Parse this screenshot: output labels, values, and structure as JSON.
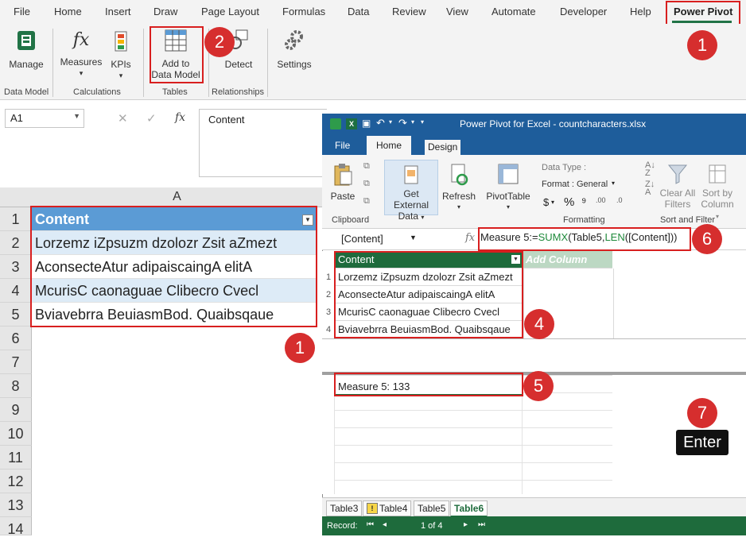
{
  "excel": {
    "menu": [
      "File",
      "Home",
      "Insert",
      "Draw",
      "Page Layout",
      "Formulas",
      "Data",
      "Review",
      "View",
      "Automate",
      "Developer",
      "Help",
      "Power Pivot"
    ],
    "ribbon": {
      "manage": "Manage",
      "measures": "Measures",
      "kpis": "KPIs",
      "add_to_data_model_1": "Add to",
      "add_to_data_model_2": "Data Model",
      "detect": "Detect",
      "settings": "Settings",
      "groups": [
        "Data Model",
        "Calculations",
        "Tables",
        "Relationships"
      ]
    },
    "name_box": "A1",
    "fx": "fx",
    "formula_value": "Content",
    "column_header": "A",
    "rows": [
      "1",
      "2",
      "3",
      "4",
      "5",
      "6",
      "7",
      "8",
      "9",
      "10",
      "11",
      "12",
      "13",
      "14"
    ],
    "cells": [
      "Content",
      "Lorzemz iZpsuzm dzolozr Zsit aZmezt",
      "AconsecteAtur adipaiscaingA elitA",
      "McurisC caonaguae Clibecro Cvecl",
      "Bviavebrra BeuiasmBod. Quaibsqaue"
    ]
  },
  "callouts": [
    "1",
    "2",
    "1",
    "6",
    "4",
    "5",
    "7"
  ],
  "enter_label": "Enter",
  "powerpivot": {
    "title": "Power Pivot for Excel - countcharacters.xlsx",
    "tabs": [
      "File",
      "Home",
      "Design"
    ],
    "ribbon": {
      "paste": "Paste",
      "get_external_1": "Get External",
      "get_external_2": "Data",
      "refresh": "Refresh",
      "pivottable": "PivotTable",
      "data_type": "Data Type :",
      "format": "Format : General",
      "clear_filters_1": "Clear All",
      "clear_filters_2": "Filters",
      "sort_col_1": "Sort by",
      "sort_col_2": "Column",
      "groups": [
        "Clipboard",
        "Formatting",
        "Sort and Filter"
      ]
    },
    "column_selector": "[Content]",
    "formula_prefix": "Measure 5:=",
    "formula_fn1": "SUMX",
    "formula_mid": "(Table5,",
    "formula_fn2": "LEN",
    "formula_end": "([Content]))",
    "grid_header": "Content",
    "add_column": "Add Column",
    "grid_rows": [
      "1",
      "2",
      "3",
      "4"
    ],
    "grid_values": [
      "Lorzemz iZpsuzm dzolozr Zsit aZmezt",
      "AconsecteAtur adipaiscaingA elitA",
      "McurisC caonaguae Clibecro Cvecl",
      "Bviavebrra BeuiasmBod. Quaibsqaue"
    ],
    "measure": "Measure 5: 133",
    "sheet_tabs": [
      "Table3",
      "Table4",
      "Table5",
      "Table6"
    ],
    "record_label": "Record:",
    "record_position": "1 of 4"
  },
  "colors": {
    "excel_green": "#217346",
    "pp_blue": "#1e5d9b",
    "callout_red": "#d62e2e",
    "table_header": "#5b9bd5",
    "band": "#ddebf7"
  }
}
